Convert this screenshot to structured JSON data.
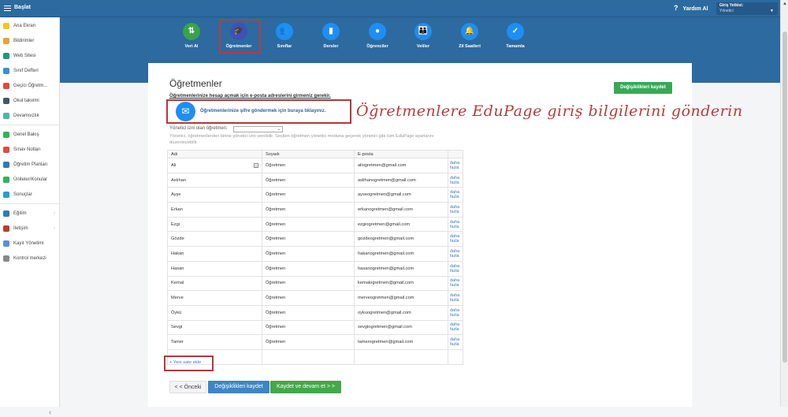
{
  "topbar": {
    "title": "Başlat",
    "help": "Yardım Al",
    "role_label": "Giriş Yetkisi:",
    "role_value": "Yönetici"
  },
  "sidebar": {
    "items": [
      {
        "label": "Ana Ekran",
        "icon": "star-icon",
        "color": "#f5c518"
      },
      {
        "label": "Bildirimler",
        "icon": "envelope-icon",
        "color": "#f0a030"
      },
      {
        "label": "Web Sitesi",
        "icon": "house-icon",
        "color": "#1a9c7a"
      },
      {
        "label": "Sınıf Defteri",
        "icon": "book-icon",
        "color": "#3a8fd9"
      },
      {
        "label": "Geçici Öğretm...",
        "icon": "substitute-icon",
        "color": "#e04b3c"
      },
      {
        "label": "Okul takvimi",
        "icon": "calendar-icon",
        "color": "#445566"
      },
      {
        "label": "Devamsızlık",
        "icon": "person-icon",
        "color": "#4bb8a0"
      },
      {
        "label": "Genel Bakış",
        "icon": "check-circle-icon",
        "color": "#2fb35a"
      },
      {
        "label": "Sınav Notları",
        "icon": "grade-icon",
        "color": "#e04b3c"
      },
      {
        "label": "Öğretim Planları",
        "icon": "briefcase-icon",
        "color": "#2a7bbf"
      },
      {
        "label": "Üniteler/Konular",
        "icon": "shield-icon",
        "color": "#2fb35a"
      },
      {
        "label": "Sonuçlar",
        "icon": "bar-chart-icon",
        "color": "#1fa0d8"
      },
      {
        "label": "Eğitim",
        "icon": "school-icon",
        "color": "#2a7bbf",
        "chevron": true
      },
      {
        "label": "İletişim",
        "icon": "chat-icon",
        "color": "#c0392b",
        "chevron": true
      },
      {
        "label": "Kayıt Yönetimi",
        "icon": "pencil-icon",
        "color": "#5a8fd6"
      },
      {
        "label": "Kontrol merkezi",
        "icon": "gear-icon",
        "color": "#888888"
      }
    ]
  },
  "steps": [
    {
      "label": "Veri Al",
      "glyph": "⇅",
      "color": "#3aa34a"
    },
    {
      "label": "Öğretmenler",
      "glyph": "🎓",
      "color": "#3f51b5",
      "active": true
    },
    {
      "label": "Sınıflar",
      "glyph": "👥",
      "color": "#1f8ef1"
    },
    {
      "label": "Dersler",
      "glyph": "▮",
      "color": "#1f8ef1"
    },
    {
      "label": "Öğrenciler",
      "glyph": "●",
      "color": "#1f8ef1"
    },
    {
      "label": "Veliler",
      "glyph": "👪",
      "color": "#1f8ef1"
    },
    {
      "label": "Zil Saatleri",
      "glyph": "🔔",
      "color": "#1f8ef1"
    },
    {
      "label": "Tamamla",
      "glyph": "✓",
      "color": "#1f8ef1"
    }
  ],
  "main": {
    "title": "Öğretmenler",
    "save_top": "Değişiklikleri kaydet",
    "notice": "Öğretmenlerinize hesap açmak için e-posta adreslerini girmeniz gerekir.",
    "send_link": "Öğretmenlerinize şifre göndermek için buraya tıklayınız.",
    "annotation": "Öğretmenlere EduPage giriş bilgilerini gönderin",
    "admin_label": "Yönetici izni olan öğretmen:",
    "admin_value": "",
    "admin_help": "Yönetici, öğretmenlerden birine yönetici izni verebilir. Seçilen öğretmen yönetici moduna geçerek yönetici gibi tüm EduPage ayarlarını düzenleyebilir.",
    "columns": [
      "Adı",
      "Soyadı",
      "E-posta",
      ""
    ],
    "more_label_1": "daha",
    "more_label_2": "fazla",
    "rows": [
      {
        "first": "Ali",
        "last": "Öğretmen",
        "email": "aliogretmen@gmail.com"
      },
      {
        "first": "Aslıhan",
        "last": "Öğretmen",
        "email": "aslihanogretmen@gmail.com"
      },
      {
        "first": "Ayşe",
        "last": "Öğretmen",
        "email": "ayseogretmen@gmail.com"
      },
      {
        "first": "Erkan",
        "last": "Öğretmen",
        "email": "erkanogretmen@gmail.com"
      },
      {
        "first": "Ezgi",
        "last": "Öğretmen",
        "email": "ezgiogretmen@gmail.com"
      },
      {
        "first": "Gözde",
        "last": "Öğretmen",
        "email": "gozdeogretmen@gmail.com"
      },
      {
        "first": "Hakan",
        "last": "Öğretmen",
        "email": "hakanogretmen@gmail.com"
      },
      {
        "first": "Hasan",
        "last": "Öğretmen",
        "email": "hasanogretmen@gmail.com"
      },
      {
        "first": "Kemal",
        "last": "Öğretmen",
        "email": "kemalogretmen@gmail.com"
      },
      {
        "first": "Merve",
        "last": "Öğretmen",
        "email": "merveogretmen@gmail.com"
      },
      {
        "first": "Öykü",
        "last": "Öğretmen",
        "email": "oykuogretmen@gmail.com"
      },
      {
        "first": "Sevgi",
        "last": "Öğretmen",
        "email": "sevgiogretmen@gmail.com"
      },
      {
        "first": "Tamer",
        "last": "Öğretmen",
        "email": "tamerogretmen@gmail.com"
      }
    ],
    "new_row": "+ Yeni satır ekle",
    "prev": "< < Önceki",
    "save_bottom": "Değişiklikleri kaydet",
    "save_next": "Kaydet ve devam et > >"
  }
}
